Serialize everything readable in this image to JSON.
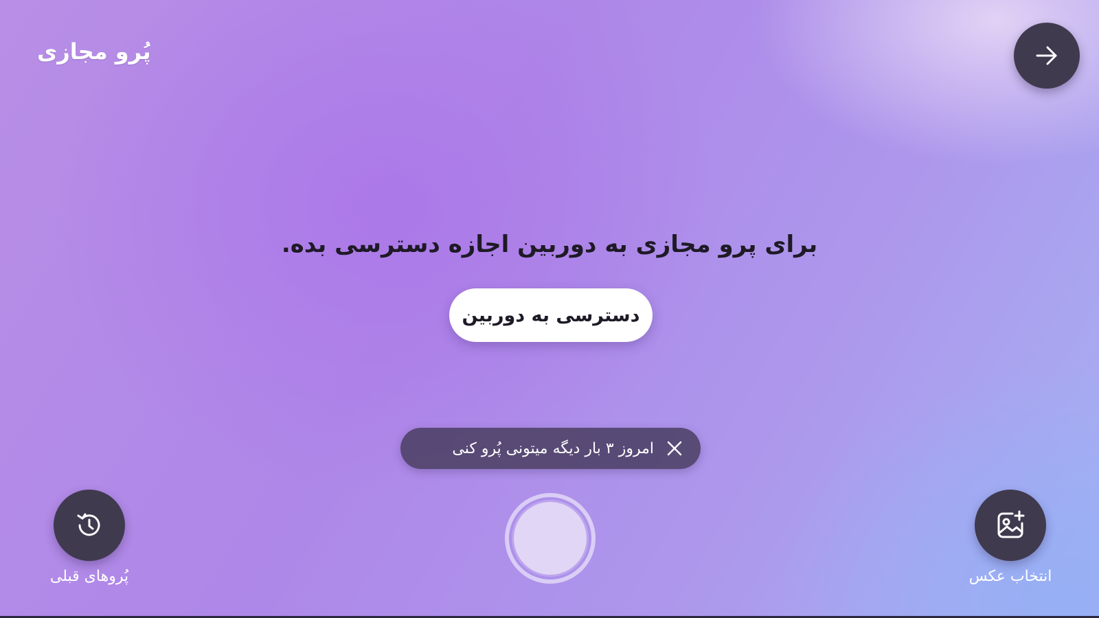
{
  "header": {
    "title": "پُرو مجازی",
    "back_icon": "arrow-right-icon"
  },
  "main": {
    "prompt": "برای پرو مجازی به دوربین اجازه دسترسی بده.",
    "camera_access_label": "دسترسی به دوربین"
  },
  "toast": {
    "message": "امروز ۳ بار دیگه میتونی پُرو کنی",
    "close_icon": "close-icon"
  },
  "bottom": {
    "history_label": "پُروهای قبلی",
    "history_icon": "history-icon",
    "gallery_label": "انتخاب عکس",
    "gallery_icon": "add-photo-icon",
    "shutter_icon": "shutter-icon"
  },
  "colors": {
    "accent_dark": "#403a4f",
    "background_purple": "#ae87e8",
    "background_blue": "#a6b2f2"
  }
}
